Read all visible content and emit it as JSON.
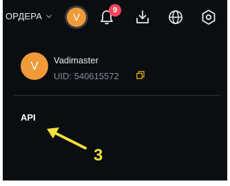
{
  "header": {
    "orders_label": "ОРДЕРА",
    "avatar_initial": "V",
    "notification_count": "9",
    "icons": [
      "chevron-down-icon",
      "bell-icon",
      "download-icon",
      "globe-icon",
      "settings-icon"
    ]
  },
  "profile": {
    "avatar_initial": "V",
    "username": "Vadimaster",
    "uid": "UID: 540615572"
  },
  "menu": {
    "api_label": "API"
  },
  "annotation": {
    "step_number": "3",
    "color": "#f2e03a"
  },
  "colors": {
    "background": "#0b0e11",
    "avatar": "#f09a3a",
    "badge": "#f6465d",
    "accent_copy": "#f0b90b"
  }
}
